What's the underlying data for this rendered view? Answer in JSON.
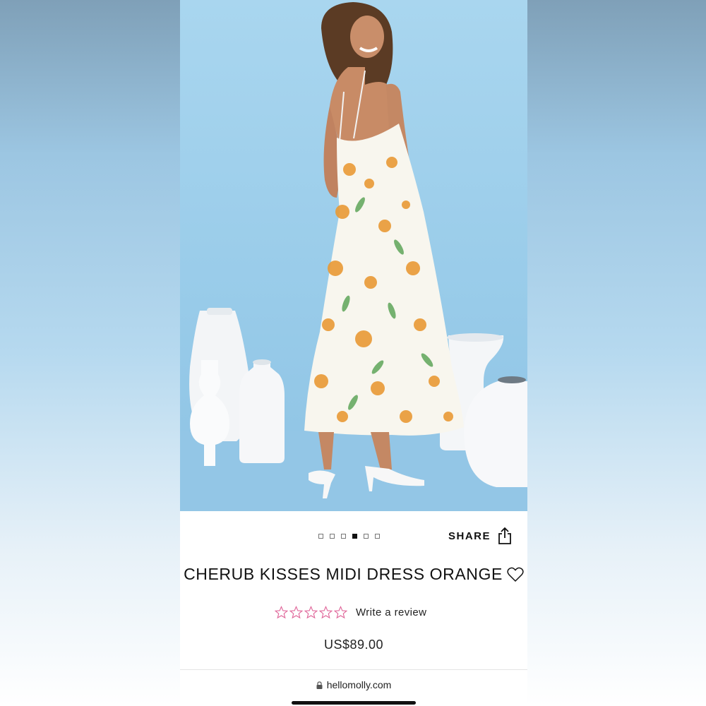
{
  "product": {
    "title": "CHERUB KISSES MIDI DRESS ORANGE",
    "rating": 0,
    "rating_max": 5,
    "review_link": "Write a review",
    "price": "US$89.00"
  },
  "gallery": {
    "image_count": 6,
    "active_index": 3
  },
  "share": {
    "label": "SHARE"
  },
  "browser": {
    "url": "hellomolly.com"
  },
  "colors": {
    "background_blue": "#98cbe9",
    "star_outline": "#e0679a",
    "text": "#111111"
  },
  "icons": [
    "share-icon",
    "heart-icon",
    "star-icon",
    "lock-icon"
  ]
}
